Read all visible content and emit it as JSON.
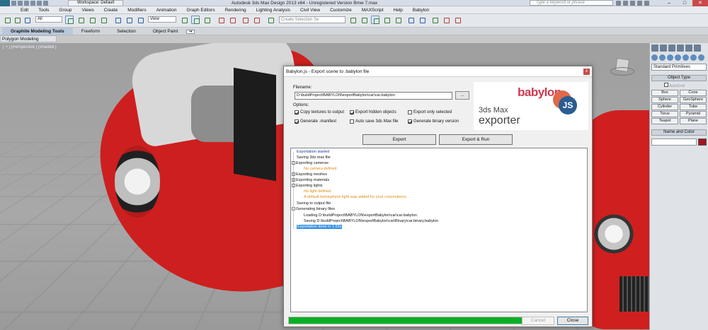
{
  "titlebar": {
    "app_icon": "MAX",
    "workspace": "Workspace: Default",
    "window_title": "Autodesk 3ds Max Design 2013 x64 - Unregistered Version   Bmw 7.max",
    "search_placeholder": "Type a keyword or phrase"
  },
  "menubar": [
    "Edit",
    "Tools",
    "Group",
    "Views",
    "Create",
    "Modifiers",
    "Animation",
    "Graph Editors",
    "Rendering",
    "Lighting Analysis",
    "Civil View",
    "Customize",
    "MAXScript",
    "Help",
    "Babylon"
  ],
  "toolbar": {
    "filter_select": "All",
    "view_select": "View",
    "selection_set_placeholder": "Create Selection Se"
  },
  "ribbon": {
    "tabs": [
      "Graphite Modeling Tools",
      "Freeform",
      "Selection",
      "Object Paint"
    ],
    "toggle": "▪▾",
    "subpanel": "Polygon Modeling"
  },
  "viewport": {
    "label": "[ + ] [Perspective ] [Shaded ]"
  },
  "command_panel": {
    "category": "Standard Primitives",
    "object_type_title": "Object Type",
    "autogrid": "AutoGrid",
    "objects": [
      "Box",
      "Cone",
      "Sphere",
      "GeoSphere",
      "Cylinder",
      "Tube",
      "Torus",
      "Pyramid",
      "Teapot",
      "Plane"
    ],
    "name_and_color_title": "Name and Color",
    "color": "#a21523"
  },
  "dialog": {
    "title": "Babylon.js - Export scene to .babylon file",
    "close_glyph": "x",
    "filename_label": "Filename:",
    "filename_value": "D:\\buildProject\\BABYLON\\exportBabylon\\car\\car.babylon",
    "browse_label": "...",
    "options_label": "Options:",
    "options": [
      {
        "label": "Copy textures to output",
        "checked": true
      },
      {
        "label": "Export hidden objects",
        "checked": true
      },
      {
        "label": "Export only selected",
        "checked": false
      },
      {
        "label": "Generate .manifest",
        "checked": true
      },
      {
        "label": "Auto save 3ds Max file",
        "checked": false
      },
      {
        "label": "Generate binary version",
        "checked": true
      }
    ],
    "logo": {
      "brand": "babylon",
      "js": "JS",
      "product": "3ds Max",
      "exporter": "exporter"
    },
    "export_button": "Export",
    "export_run_button": "Export & Run",
    "log": [
      {
        "text": "Exportation started",
        "color": "blue",
        "expander": ""
      },
      {
        "text": "Saving 3ds max file",
        "color": "black",
        "expander": ""
      },
      {
        "text": "Exporting cameras",
        "color": "black",
        "expander": "-"
      },
      {
        "text": "No camera defined",
        "color": "orange",
        "expander": ""
      },
      {
        "text": "Exporting meshes",
        "color": "black",
        "expander": "+"
      },
      {
        "text": "Exporting materials",
        "color": "black",
        "expander": "+"
      },
      {
        "text": "Exporting lights",
        "color": "black",
        "expander": "-"
      },
      {
        "text": "No light defined",
        "color": "orange",
        "expander": ""
      },
      {
        "text": "A default hemispheric light was added for your convenience",
        "color": "orange",
        "expander": ""
      },
      {
        "text": "Saving to output file",
        "color": "black",
        "expander": ""
      },
      {
        "text": "Generating binary files",
        "color": "black",
        "expander": "-"
      },
      {
        "text": "Loading D:\\buildProject\\BABYLON\\exportBabylon\\car\\car.babylon",
        "color": "black",
        "expander": ""
      },
      {
        "text": "Saving D:\\buildProject\\BABYLON\\exportBabylon\\car\\Binary\\car.binary.babylon",
        "color": "black",
        "expander": ""
      },
      {
        "text": "Exportation done in 1.55s",
        "color": "black",
        "expander": "",
        "selected": true
      }
    ],
    "progress": 1.0,
    "cancel_button": "Cancel",
    "close_button": "Close"
  }
}
